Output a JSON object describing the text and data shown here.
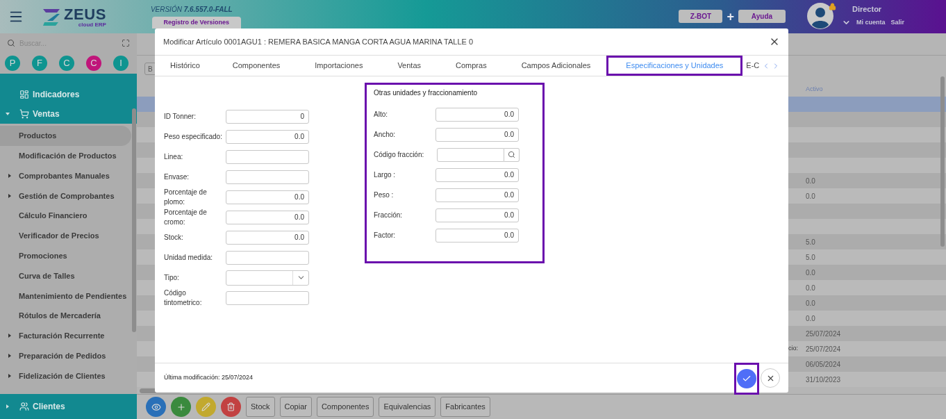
{
  "header": {
    "logo": {
      "name": "ZEUS",
      "tagline": "cloud ERP"
    },
    "version": "VERSIÓN **7.6.557.0-FALL**",
    "version_tab": "Registro de Versiones",
    "buttons": [
      "Z-BOT",
      "Ayuda"
    ],
    "plus": "+",
    "user": {
      "name": "Director",
      "links": [
        "Mi cuenta",
        "Salir"
      ],
      "locked": true
    }
  },
  "sidebar": {
    "search": {
      "placeholder": "Buscar..."
    },
    "shortcuts": [
      {
        "letter": "P",
        "color": "#0f9490"
      },
      {
        "letter": "F",
        "color": "#0f9490"
      },
      {
        "letter": "C",
        "color": "#0f9490"
      },
      {
        "letter": "C",
        "color": "#c0157a"
      },
      {
        "letter": "I",
        "color": "#0f9490"
      }
    ],
    "sections": [
      {
        "label": "Indicadores",
        "kind": "dashboard"
      },
      {
        "label": "Ventas",
        "kind": "sales",
        "expanded": true,
        "children": [
          {
            "label": "Productos",
            "selected": true,
            "expandable": false
          },
          {
            "label": "Modificación de Productos",
            "selected": false,
            "expandable": false
          },
          {
            "label": "Comprobantes Manuales",
            "selected": false,
            "expandable": true
          },
          {
            "label": "Gestión de Comprobantes",
            "selected": false,
            "expandable": true
          },
          {
            "label": "Cálculo Financiero",
            "selected": false,
            "expandable": false
          },
          {
            "label": "Verificador de Precios",
            "selected": false,
            "expandable": false
          },
          {
            "label": "Promociones",
            "selected": false,
            "expandable": false
          },
          {
            "label": "Curva de Talles",
            "selected": false,
            "expandable": false
          },
          {
            "label": "Mantenimiento de Pendientes",
            "selected": false,
            "expandable": false
          },
          {
            "label": "Rótulos de Mercadería",
            "selected": false,
            "expandable": false
          },
          {
            "label": "Facturación Recurrente",
            "selected": false,
            "expandable": true
          },
          {
            "label": "Preparación de Pedidos",
            "selected": false,
            "expandable": true
          },
          {
            "label": "Fidelización de Clientes",
            "selected": false,
            "expandable": true
          }
        ]
      }
    ],
    "bottom_section": {
      "label": "Clientes",
      "kind": "clients",
      "expanded": false
    }
  },
  "background": {
    "toolbar_button": "B",
    "table": {
      "column": "Activo",
      "rows": [
        {
          "selected": true
        },
        {
          "selected": false
        },
        {
          "selected": false
        },
        {
          "selected": false
        },
        {
          "selected": false
        },
        {
          "selected": false,
          "activo": "0.0"
        },
        {
          "selected": false,
          "activo": "0.0"
        },
        {
          "selected": false
        },
        {
          "selected": false
        },
        {
          "selected": false,
          "activo": "5.0"
        },
        {
          "selected": false,
          "activo": "5.0"
        },
        {
          "selected": false,
          "activo": "0.0"
        },
        {
          "selected": false,
          "activo": "0.0"
        },
        {
          "selected": false,
          "activo": "0.0"
        },
        {
          "selected": false,
          "activo": "0.0"
        },
        {
          "selected": false,
          "activo": "25/07/2024"
        },
        {
          "selected": false,
          "activo": "25/07/2024",
          "label": "cio:"
        },
        {
          "selected": false,
          "activo": "06/05/2024"
        },
        {
          "selected": false,
          "activo": "31/10/2023"
        }
      ]
    },
    "actions": [
      {
        "kind": "view"
      },
      {
        "kind": "add"
      },
      {
        "kind": "edit"
      },
      {
        "kind": "delete"
      }
    ],
    "buttons": [
      "Stock",
      "Copiar",
      "Componentes",
      "Equivalencias",
      "Fabricantes"
    ]
  },
  "dialog": {
    "title": "Modificar Artículo 0001AGU1 : REMERA BASICA MANGA CORTA AGUA MARINA TALLE 0",
    "tabs": [
      {
        "label": "Histórico",
        "selected": false,
        "highlighted": false
      },
      {
        "label": "Componentes",
        "selected": false,
        "highlighted": false
      },
      {
        "label": "Importaciones",
        "selected": false,
        "highlighted": false
      },
      {
        "label": "Ventas",
        "selected": false,
        "highlighted": false
      },
      {
        "label": "Compras",
        "selected": false,
        "highlighted": false
      },
      {
        "label": "Campos Adicionales",
        "selected": false,
        "highlighted": false
      },
      {
        "label": "Especificaciones y Unidades",
        "selected": true,
        "highlighted": true
      },
      {
        "label": "E-C",
        "selected": false,
        "highlighted": false
      }
    ],
    "fields": [
      {
        "label": "ID Tonner:",
        "kind": "text",
        "value": "0"
      },
      {
        "label": "Peso especificado:",
        "kind": "text",
        "value": "0.0"
      },
      {
        "label": "Linea:",
        "kind": "text"
      },
      {
        "label": "Envase:",
        "kind": "text"
      },
      {
        "label": "Porcentaje de plomo:",
        "kind": "text",
        "value": "0.0"
      },
      {
        "label": "Porcentaje de cromo:",
        "kind": "text",
        "value": "0.0"
      },
      {
        "label": "Stock:",
        "kind": "text",
        "value": "0.0"
      },
      {
        "label": "Unidad medida:",
        "kind": "text"
      },
      {
        "label": "Tipo:",
        "kind": "select"
      },
      {
        "label": "Código tintometrico:",
        "kind": "text"
      }
    ],
    "panel": {
      "title": "Otras unidades y fraccionamiento",
      "highlighted": true,
      "fields": [
        {
          "label": "Alto:",
          "kind": "text",
          "value": "0.0"
        },
        {
          "label": "Ancho:",
          "kind": "text",
          "value": "0.0"
        },
        {
          "label": "Código fracción:",
          "kind": "search"
        },
        {
          "label": "Largo :",
          "kind": "text",
          "value": "0.0"
        },
        {
          "label": "Peso :",
          "kind": "text",
          "value": "0.0"
        },
        {
          "label": "Fracción:",
          "kind": "text",
          "value": "0.0"
        },
        {
          "label": "Factor:",
          "kind": "text",
          "value": "0.0"
        }
      ]
    },
    "footer": "Última modificación: 25/07/2024",
    "confirm_highlighted": true
  }
}
